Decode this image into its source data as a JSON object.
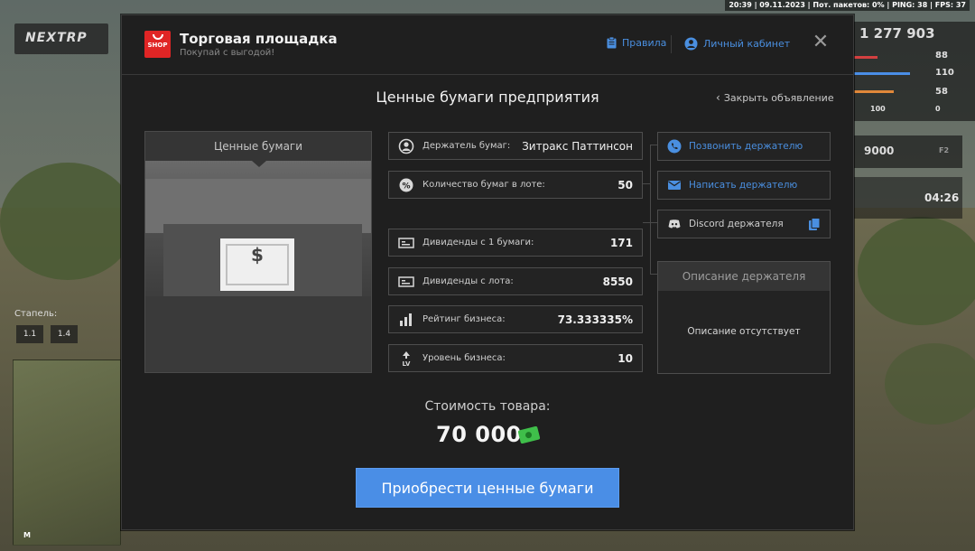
{
  "hud": {
    "status_line": "20:39 | 09.11.2023 | Пот. пакетов: 0% | PING: 38 | FPS: 37",
    "logo_text": "NEXTRP",
    "money": "1 277 903",
    "stats": [
      "88",
      "110",
      "58",
      "100",
      "0"
    ],
    "cash": "9000",
    "key_hint": "F2",
    "timer": "04:26",
    "speed_label": "Стапель:",
    "speed_values": [
      "1.1",
      "1.4"
    ],
    "minimap_marker": "M"
  },
  "header": {
    "title": "Торговая площадка",
    "subtitle": "Покупай с выгодой!",
    "logo_text": "SHOP",
    "rules_label": "Правила",
    "cabinet_label": "Личный кабинет",
    "close_symbol": "✕"
  },
  "listing": {
    "title": "Ценные бумаги предприятия",
    "close_ad_label": "Закрыть объявление",
    "image_caption": "Ценные бумаги",
    "rows": [
      {
        "label": "Держатель бумаг:",
        "value": "Зитракс Паттинсон",
        "icon": "user-icon"
      },
      {
        "label": "Количество бумаг в лоте:",
        "value": "50",
        "icon": "percent-badge-icon"
      },
      {
        "label": "Дивиденды с 1 бумаги:",
        "value": "171",
        "icon": "banknote-icon"
      },
      {
        "label": "Дивиденды с лота:",
        "value": "8550",
        "icon": "banknote-icon"
      },
      {
        "label": "Рейтинг бизнеса:",
        "value": "73.333335%",
        "icon": "chart-icon"
      },
      {
        "label": "Уровень бизнеса:",
        "value": "10",
        "icon": "level-icon"
      }
    ],
    "actions": {
      "call": "Позвонить держателю",
      "message": "Написать держателю",
      "discord": "Discord держателя"
    },
    "description": {
      "title": "Описание держателя",
      "text": "Описание отсутствует"
    },
    "price_label": "Стоимость товара:",
    "price_value": "70 000",
    "buy_label": "Приобрести ценные бумаги"
  },
  "colors": {
    "accent": "#4a8ee6",
    "link": "#4a8fe0",
    "panel": "#1f1f1f",
    "shop_red": "#e02525",
    "money_green": "#3fbf4a"
  }
}
